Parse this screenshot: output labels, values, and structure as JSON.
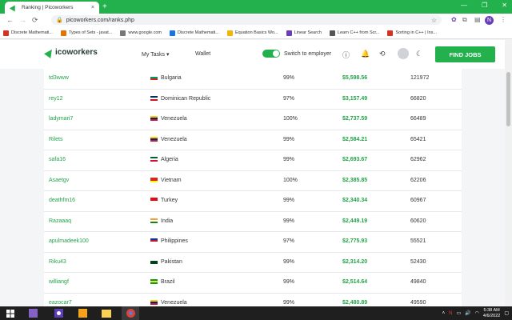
{
  "browser": {
    "tab_title": "Ranking | Picoworkers",
    "tab_close": "×",
    "new_tab": "+",
    "url": "picoworkers.com/ranks.php",
    "profile_initial": "N",
    "window_controls": [
      "—",
      "❐",
      "✕"
    ]
  },
  "bookmarks": [
    {
      "label": "Discrete Mathemati...",
      "color": "#d93025"
    },
    {
      "label": "Types of Sets - javat...",
      "color": "#e37400"
    },
    {
      "label": "www.google.com",
      "color": "#777777"
    },
    {
      "label": "Discrete Mathemati...",
      "color": "#1a73e8"
    },
    {
      "label": "Equation Basics Wo...",
      "color": "#f4b400"
    },
    {
      "label": "Linear Search",
      "color": "#6a3fb5"
    },
    {
      "label": "Learn C++ from Scr...",
      "color": "#555555"
    },
    {
      "label": "Sorting in C++ | Ins...",
      "color": "#d93025"
    }
  ],
  "site": {
    "logo_text": "icoworkers",
    "my_tasks": "My Tasks ▾",
    "wallet": "Wallet",
    "switch_label": "Switch to employer",
    "find_jobs": "FIND JOBS",
    "accent": "#22b14c"
  },
  "ranking": [
    {
      "name": "td3www",
      "country": "Bulgaria",
      "flag": [
        "#ffffff",
        "#00966e",
        "#d62612"
      ],
      "rate": "99%",
      "earned": "$5,598.56",
      "points": "121972"
    },
    {
      "name": "rey12",
      "country": "Dominican Republic",
      "flag": [
        "#002d62",
        "#ffffff",
        "#ce1126"
      ],
      "rate": "97%",
      "earned": "$3,157.49",
      "points": "66820"
    },
    {
      "name": "ladymari7",
      "country": "Venezuela",
      "flag": [
        "#ffcc00",
        "#00247d",
        "#cf142b"
      ],
      "rate": "100%",
      "earned": "$2,737.59",
      "points": "66489"
    },
    {
      "name": "Rilets",
      "country": "Venezuela",
      "flag": [
        "#ffcc00",
        "#00247d",
        "#cf142b"
      ],
      "rate": "99%",
      "earned": "$2,584.21",
      "points": "65421"
    },
    {
      "name": "safa16",
      "country": "Algeria",
      "flag": [
        "#006233",
        "#ffffff",
        "#d21034"
      ],
      "rate": "99%",
      "earned": "$2,693.67",
      "points": "62962"
    },
    {
      "name": "Asaetgv",
      "country": "Vietnam",
      "flag": [
        "#da251d",
        "#da251d",
        "#ffff00"
      ],
      "rate": "100%",
      "earned": "$2,385.85",
      "points": "62206"
    },
    {
      "name": "deathfm16",
      "country": "Turkey",
      "flag": [
        "#e30a17",
        "#e30a17",
        "#ffffff"
      ],
      "rate": "99%",
      "earned": "$2,340.34",
      "points": "60967"
    },
    {
      "name": "Razaaaq",
      "country": "India",
      "flag": [
        "#ff9933",
        "#ffffff",
        "#138808"
      ],
      "rate": "99%",
      "earned": "$2,449.19",
      "points": "60620"
    },
    {
      "name": "apulmadeek100",
      "country": "Philippines",
      "flag": [
        "#0038a8",
        "#ce1126",
        "#ffffff"
      ],
      "rate": "97%",
      "earned": "$2,775.93",
      "points": "55521"
    },
    {
      "name": "Riku43",
      "country": "Pakistan",
      "flag": [
        "#ffffff",
        "#01411c",
        "#01411c"
      ],
      "rate": "99%",
      "earned": "$2,314.20",
      "points": "52430"
    },
    {
      "name": "williangf",
      "country": "Brazil",
      "flag": [
        "#009c3b",
        "#ffdf00",
        "#009c3b"
      ],
      "rate": "99%",
      "earned": "$2,514.64",
      "points": "49840"
    },
    {
      "name": "eazocar7",
      "country": "Venezuela",
      "flag": [
        "#ffcc00",
        "#00247d",
        "#cf142b"
      ],
      "rate": "99%",
      "earned": "$2,480.89",
      "points": "49590"
    }
  ],
  "taskbar": {
    "time": "5:38 AM",
    "date": "4/6/2022"
  }
}
